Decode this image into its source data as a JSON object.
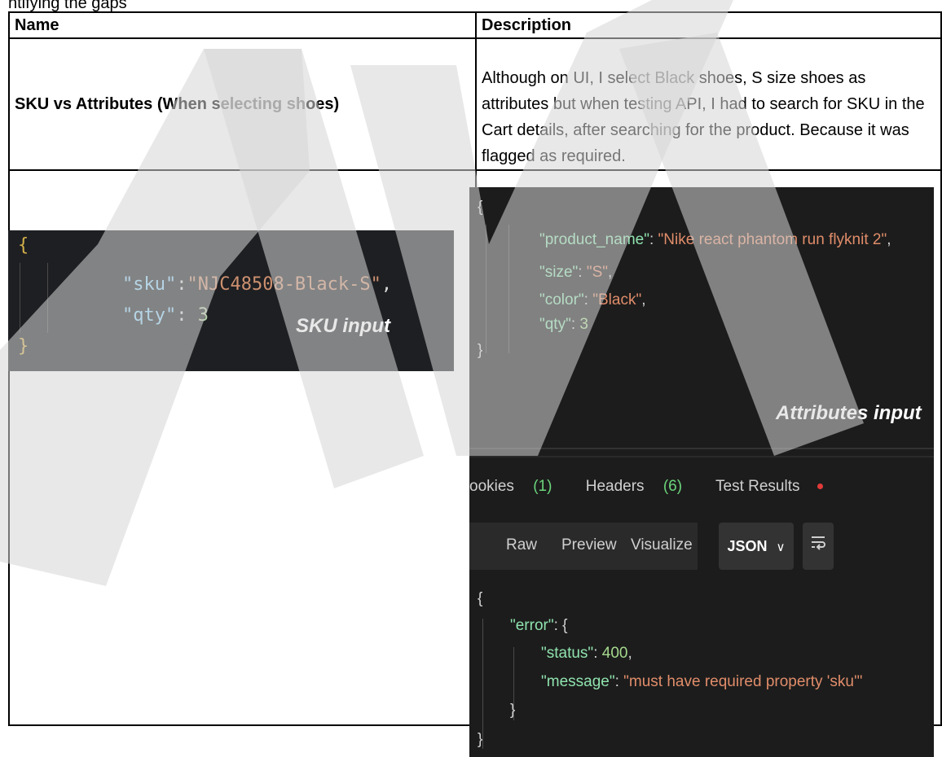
{
  "top_text": "ntifying the gaps",
  "table": {
    "headers": {
      "name": "Name",
      "description": "Description"
    },
    "row1": {
      "name": "SKU vs Attributes (When selecting shoes)",
      "description": "Although on UI, I select Black shoes, S size shoes as attributes but when testing API, I had to search for SKU in the Cart details, after searching for the product. Because it was flagged as required."
    }
  },
  "sku_panel": {
    "open_brace": "{",
    "close_brace": "}",
    "line1_key": "\"sku\"",
    "line1_value": "\"NJC48508-Black-S\"",
    "line2_key": "\"qty\"",
    "line2_value": "3",
    "label": "SKU input"
  },
  "attributes_panel": {
    "open_brace": "{",
    "close_brace": "}",
    "lines": [
      {
        "key": "\"product_name\"",
        "value": "\"Nike react phantom run flyknit 2\"",
        "type": "str",
        "trail": ","
      },
      {
        "key": "\"size\"",
        "value": "\"S\"",
        "type": "str",
        "trail": ","
      },
      {
        "key": "\"color\"",
        "value": "\"Black\"",
        "type": "str",
        "trail": ","
      },
      {
        "key": "\"qty\"",
        "value": "3",
        "type": "num",
        "trail": ""
      }
    ],
    "label": "Attributes input"
  },
  "response_panel": {
    "tabs": {
      "cookies": "ookies",
      "cookies_count": "(1)",
      "headers": "Headers",
      "headers_count": "(6)",
      "test_results": "Test Results"
    },
    "toolbar": {
      "raw": "Raw",
      "preview": "Preview",
      "visualize": "Visualize",
      "format": "JSON",
      "format_chevron": "∨",
      "wrap_icon": "wrap-lines-icon"
    },
    "body": {
      "open_brace": "{",
      "error_key": "\"error\"",
      "status_key": "\"status\"",
      "status_value": "400",
      "message_key": "\"message\"",
      "message_value": "\"must have required property 'sku'\"",
      "inner_close": "}",
      "outer_close": "}"
    }
  },
  "watermark_text": "MA"
}
